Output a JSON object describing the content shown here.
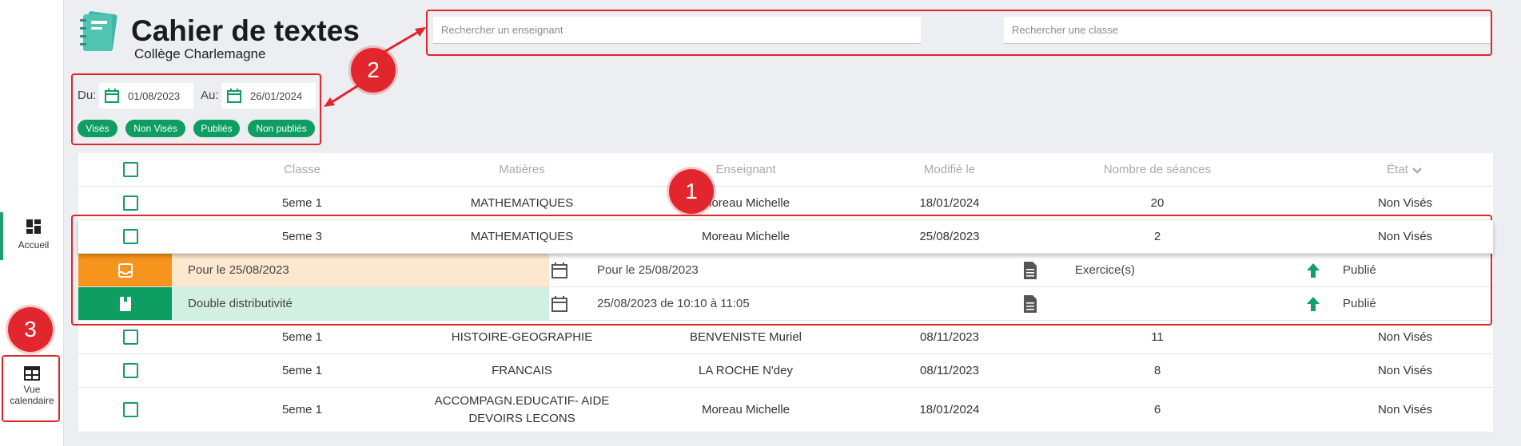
{
  "header": {
    "title": "Cahier de textes",
    "school": "Collège Charlemagne"
  },
  "search": {
    "teacher_placeholder": "Rechercher un enseignant",
    "class_placeholder": "Rechercher une classe"
  },
  "filters": {
    "from_label": "Du:",
    "from_date": "01/08/2023",
    "to_label": "Au:",
    "to_date": "26/01/2024",
    "chips": [
      "Visés",
      "Non Visés",
      "Publiés",
      "Non publiés"
    ]
  },
  "sidebar": {
    "home_label": "Accueil",
    "calendar_label_1": "Vue",
    "calendar_label_2": "calendaire"
  },
  "table": {
    "headers": {
      "classe": "Classe",
      "matieres": "Matières",
      "enseignant": "Enseignant",
      "modifie": "Modifié le",
      "seances": "Nombre de séances",
      "etat": "État"
    },
    "rows": [
      {
        "classe": "5eme 1",
        "matiere": "MATHEMATIQUES",
        "enseignant": "Moreau Michelle",
        "modifie": "18/01/2024",
        "seances": "20",
        "etat": "Non Visés"
      },
      {
        "classe": "5eme 3",
        "matiere": "MATHEMATIQUES",
        "enseignant": "Moreau Michelle",
        "modifie": "25/08/2023",
        "seances": "2",
        "etat": "Non Visés"
      },
      {
        "classe": "5eme 1",
        "matiere": "HISTOIRE-GEOGRAPHIE",
        "enseignant": "BENVENISTE Muriel",
        "modifie": "08/11/2023",
        "seances": "11",
        "etat": "Non Visés"
      },
      {
        "classe": "5eme 1",
        "matiere": "FRANCAIS",
        "enseignant": "LA ROCHE N'dey",
        "modifie": "08/11/2023",
        "seances": "8",
        "etat": "Non Visés"
      },
      {
        "classe": "5eme 1",
        "matiere_line1": "ACCOMPAGN.EDUCATIF- AIDE",
        "matiere_line2": "DEVOIRS LECONS",
        "enseignant": "Moreau Michelle",
        "modifie": "18/01/2024",
        "seances": "6",
        "etat": "Non Visés"
      }
    ],
    "sub_rows": [
      {
        "title": "Pour le 25/08/2023",
        "date": "Pour le 25/08/2023",
        "type": "Exercice(s)",
        "status": "Publié"
      },
      {
        "title": "Double distributivité",
        "date": "25/08/2023 de 10:10 à 11:05",
        "type": "",
        "status": "Publié"
      }
    ]
  },
  "annotations": [
    "1",
    "2",
    "3"
  ],
  "colors": {
    "green": "#0e9e62",
    "orange": "#f7941d",
    "orange_light": "#fde8cf",
    "green_light": "#d2efe3",
    "annotation_red": "#e1262d"
  }
}
